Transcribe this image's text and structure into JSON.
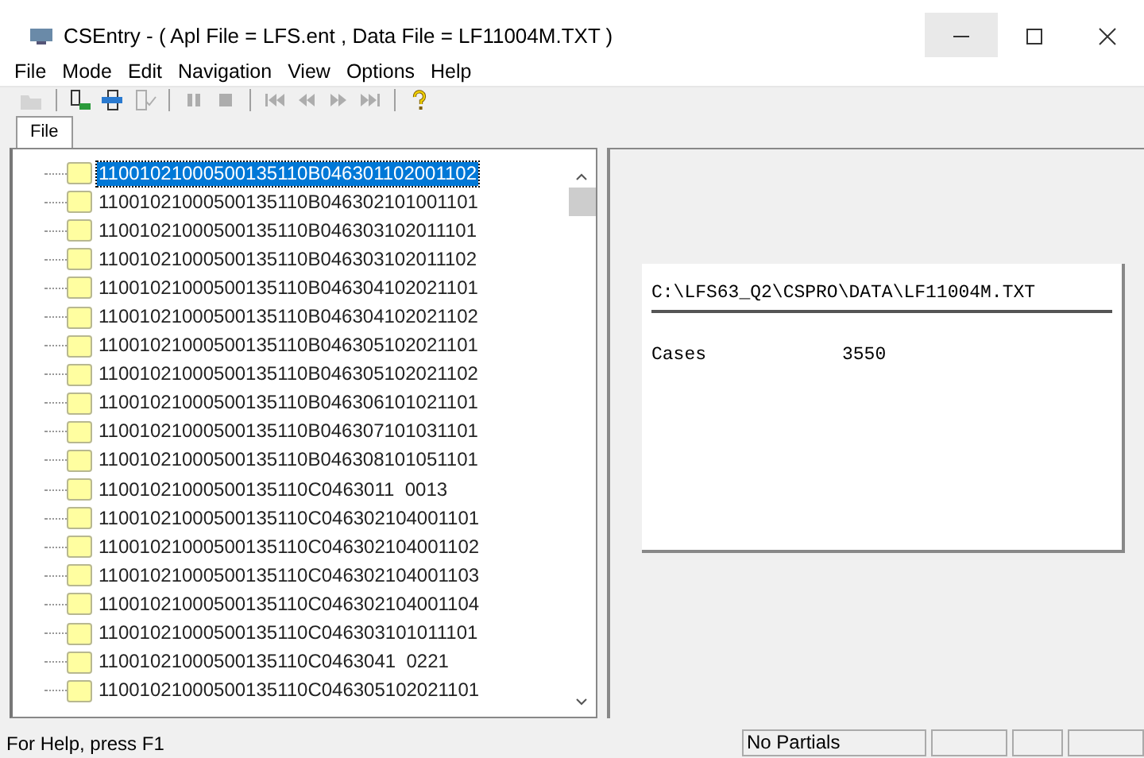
{
  "window": {
    "title": "CSEntry - ( Apl File = LFS.ent , Data File = LF11004M.TXT )"
  },
  "menu": [
    "File",
    "Mode",
    "Edit",
    "Navigation",
    "View",
    "Options",
    "Help"
  ],
  "toolbar": [
    {
      "kind": "open",
      "disabled": true
    },
    {
      "kind": "sep"
    },
    {
      "kind": "add",
      "disabled": false
    },
    {
      "kind": "insert",
      "disabled": false
    },
    {
      "kind": "verify",
      "disabled": true
    },
    {
      "kind": "sep"
    },
    {
      "kind": "pause",
      "disabled": true
    },
    {
      "kind": "stop",
      "disabled": true
    },
    {
      "kind": "sep"
    },
    {
      "kind": "first",
      "disabled": true
    },
    {
      "kind": "prev",
      "disabled": true
    },
    {
      "kind": "next",
      "disabled": true
    },
    {
      "kind": "last",
      "disabled": true
    },
    {
      "kind": "sep"
    },
    {
      "kind": "help",
      "disabled": false
    }
  ],
  "tab": {
    "label": "File",
    "selected": true
  },
  "cases": [
    {
      "label": "11001021000500135110B046301102001102",
      "selected": true
    },
    {
      "label": "11001021000500135110B046302101001101",
      "selected": false
    },
    {
      "label": "11001021000500135110B046303102011101",
      "selected": false
    },
    {
      "label": "11001021000500135110B046303102011102",
      "selected": false
    },
    {
      "label": "11001021000500135110B046304102021101",
      "selected": false
    },
    {
      "label": "11001021000500135110B046304102021102",
      "selected": false
    },
    {
      "label": "11001021000500135110B046305102021101",
      "selected": false
    },
    {
      "label": "11001021000500135110B046305102021102",
      "selected": false
    },
    {
      "label": "11001021000500135110B046306101021101",
      "selected": false
    },
    {
      "label": "11001021000500135110B046307101031101",
      "selected": false
    },
    {
      "label": "11001021000500135110B046308101051101",
      "selected": false
    },
    {
      "label": "11001021000500135110C0463011  0013",
      "selected": false
    },
    {
      "label": "11001021000500135110C046302104001101",
      "selected": false
    },
    {
      "label": "11001021000500135110C046302104001102",
      "selected": false
    },
    {
      "label": "11001021000500135110C046302104001103",
      "selected": false
    },
    {
      "label": "11001021000500135110C046302104001104",
      "selected": false
    },
    {
      "label": "11001021000500135110C046303101011101",
      "selected": false
    },
    {
      "label": "11001021000500135110C0463041  0221",
      "selected": false
    },
    {
      "label": "11001021000500135110C046305102021101",
      "selected": false
    }
  ],
  "info": {
    "path": "C:\\LFS63_Q2\\CSPRO\\DATA\\LF11004M.TXT",
    "label": "Cases",
    "value": "3550"
  },
  "status_bar": {
    "help": "For Help, press F1",
    "partials": "No Partials"
  }
}
